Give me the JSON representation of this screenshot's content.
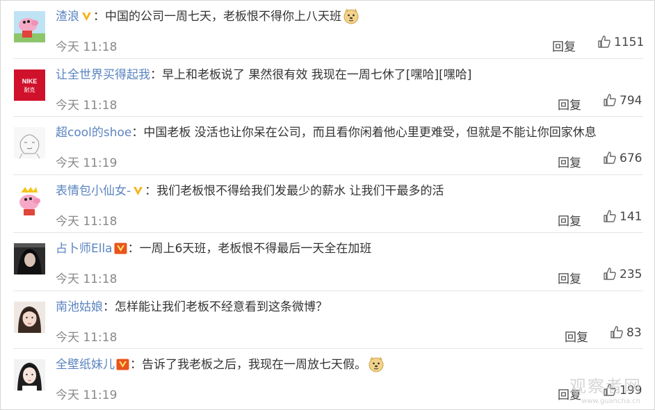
{
  "comments": [
    {
      "username": "渣浪",
      "verified": "gold",
      "text": "中国的公司一周七天，老板恨不得你上八天班",
      "emoji": "doge-emoji",
      "time": "今天 11:18",
      "reply_label": "回复",
      "likes": "1151",
      "avatar": "peppa-pig-avatar"
    },
    {
      "username": "让全世界买得起我",
      "verified": "none",
      "text": "早上和老板说了 果然很有效 我现在一周七休了[嘿哈][嘿哈]",
      "time": "今天 11:18",
      "reply_label": "回复",
      "likes": "794",
      "avatar": "nike-logo-avatar",
      "avatar_text_1": "NIKE",
      "avatar_text_2": "耐克"
    },
    {
      "username": "超cool的shoe",
      "verified": "none",
      "text": "中国老板 没活也让你呆在公司，而且看你闲着他心里更难受，但就是不能让你回家休息",
      "time": "今天 11:19",
      "reply_label": "回复",
      "likes": "676",
      "avatar": "sketch-avatar"
    },
    {
      "username": "表情包小仙女-",
      "verified": "gold",
      "text": "我们老板恨不得给我们发最少的薪水 让我们干最多的活",
      "time": "今天 11:18",
      "reply_label": "回复",
      "likes": "141",
      "avatar": "crowned-peppa-avatar"
    },
    {
      "username": "占卜师Ella",
      "verified": "red",
      "text": "一周上6天班，老板恨不得最后一天全在加班",
      "time": "今天 11:18",
      "reply_label": "回复",
      "likes": "235",
      "avatar": "dark-photo-avatar"
    },
    {
      "username": "南池姑娘",
      "verified": "none",
      "text": "怎样能让我们老板不经意看到这条微博？",
      "time": "今天 11:18",
      "reply_label": "回复",
      "likes": "83",
      "avatar": "girl-photo-avatar"
    },
    {
      "username": "全壁纸妹儿",
      "verified": "red",
      "text": "告诉了我老板之后，我现在一周放七天假。",
      "emoji": "doge-emoji",
      "time": "今天 11:19",
      "reply_label": "回复",
      "likes": "199",
      "avatar": "girl-portrait-avatar"
    }
  ],
  "watermark": {
    "text": "观察者网",
    "url": "www.guancha.cn"
  },
  "colors": {
    "username": "#5b84c1",
    "text": "#333333",
    "meta": "#888888",
    "gold_badge": "#f5b21b",
    "red_badge": "#e8541e"
  }
}
